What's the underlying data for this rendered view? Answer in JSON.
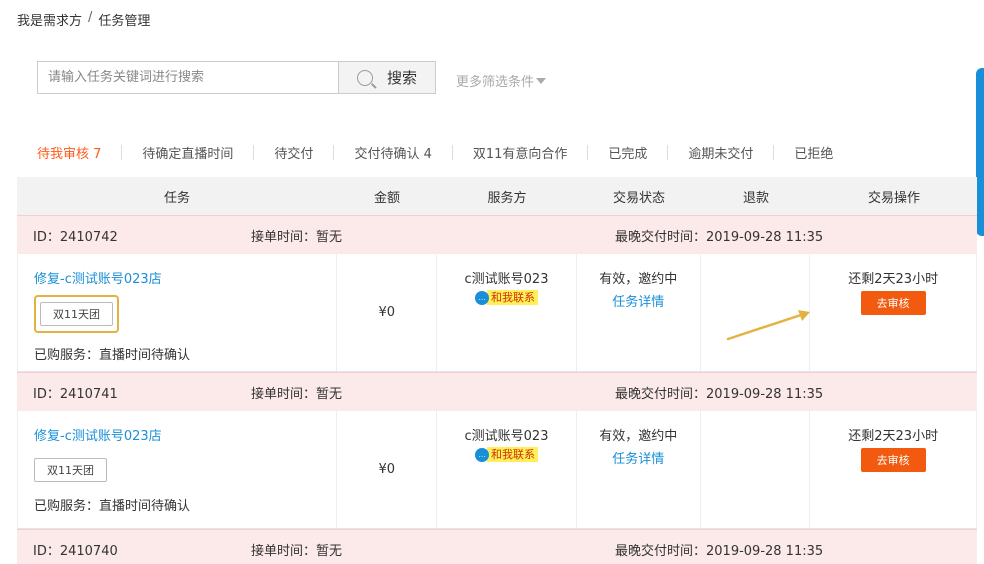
{
  "breadcrumb": {
    "root": "我是需求方",
    "separator": "/",
    "current": "任务管理"
  },
  "search": {
    "placeholder": "请输入任务关键词进行搜索",
    "button_label": "搜索",
    "more_filters": "更多筛选条件"
  },
  "tabs": [
    {
      "label": "待我审核 7",
      "active": true
    },
    {
      "label": "待确定直播时间",
      "active": false
    },
    {
      "label": "待交付",
      "active": false
    },
    {
      "label": "交付待确认 4",
      "active": false
    },
    {
      "label": "双11有意向合作",
      "active": false
    },
    {
      "label": "已完成",
      "active": false
    },
    {
      "label": "逾期未交付",
      "active": false
    },
    {
      "label": "已拒绝",
      "active": false
    }
  ],
  "table": {
    "headers": {
      "task": "任务",
      "amount": "金额",
      "provider": "服务方",
      "status": "交易状态",
      "refund": "退款",
      "operation": "交易操作"
    },
    "orders": [
      {
        "id": "ID：2410742",
        "take_time": "接单时间：暂无",
        "deadline": "最晚交付时间：2019-09-28 11:35",
        "task_name": "修复-c测试账号023店",
        "tag": "双11天团",
        "purchased": "已购服务：直播时间待确认",
        "amount": "¥0",
        "provider": "c测试账号023",
        "contact": "和我联系",
        "status": "有效，邀约中",
        "detail": "任务详情",
        "remaining": "还剩2天23小时",
        "action": "去审核"
      },
      {
        "id": "ID：2410741",
        "take_time": "接单时间：暂无",
        "deadline": "最晚交付时间：2019-09-28 11:35",
        "task_name": "修复-c测试账号023店",
        "tag": "双11天团",
        "purchased": "已购服务：直播时间待确认",
        "amount": "¥0",
        "provider": "c测试账号023",
        "contact": "和我联系",
        "status": "有效，邀约中",
        "detail": "任务详情",
        "remaining": "还剩2天23小时",
        "action": "去审核"
      },
      {
        "id": "ID：2410740",
        "take_time": "接单时间：暂无",
        "deadline": "最晚交付时间：2019-09-28 11:35"
      }
    ]
  },
  "colors": {
    "accent_orange": "#ff5a1c",
    "link_blue": "#1a8fd8",
    "order_header_bg": "#fce9e9",
    "highlight_gold": "#e3b341"
  }
}
